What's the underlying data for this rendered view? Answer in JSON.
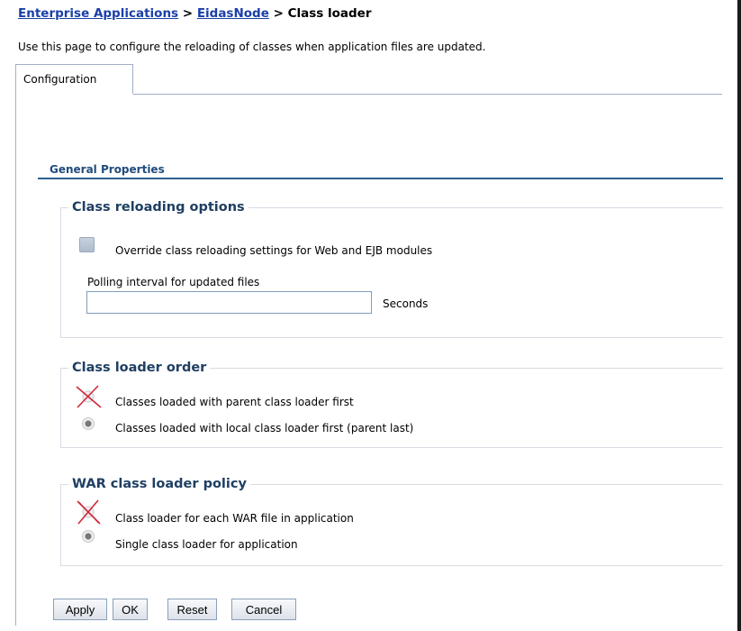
{
  "breadcrumb": {
    "link1": "Enterprise Applications",
    "sep1": " > ",
    "link2": "EidasNode",
    "sep2": " > ",
    "current": "Class loader"
  },
  "page_description": "Use this page to configure the reloading of classes when application files are updated.",
  "tabs": [
    {
      "label": "Configuration",
      "selected": true
    }
  ],
  "general_properties": {
    "title": "General Properties"
  },
  "class_reloading": {
    "legend": "Class reloading options",
    "override_label": "Override class reloading settings for Web and EJB modules",
    "override_checked": false,
    "polling_label": "Polling interval for updated files",
    "polling_value": "",
    "seconds_label": "Seconds"
  },
  "class_loader_order": {
    "legend": "Class loader order",
    "options": [
      {
        "label": "Classes loaded with parent class loader first",
        "crossed_out": true
      },
      {
        "label": "Classes loaded with local class loader first (parent last)",
        "selected": true
      }
    ]
  },
  "war_policy": {
    "legend": "WAR class loader policy",
    "options": [
      {
        "label": "Class loader for each WAR file in application",
        "crossed_out": true
      },
      {
        "label": "Single class loader for application",
        "selected": true
      }
    ]
  },
  "buttons": {
    "apply": "Apply",
    "ok": "OK",
    "reset": "Reset",
    "cancel": "Cancel"
  },
  "colors": {
    "link": "#1b3fa8",
    "section_title": "#1f4b7d",
    "legend": "#1f3f63",
    "cross_mark": "#d0273a"
  }
}
